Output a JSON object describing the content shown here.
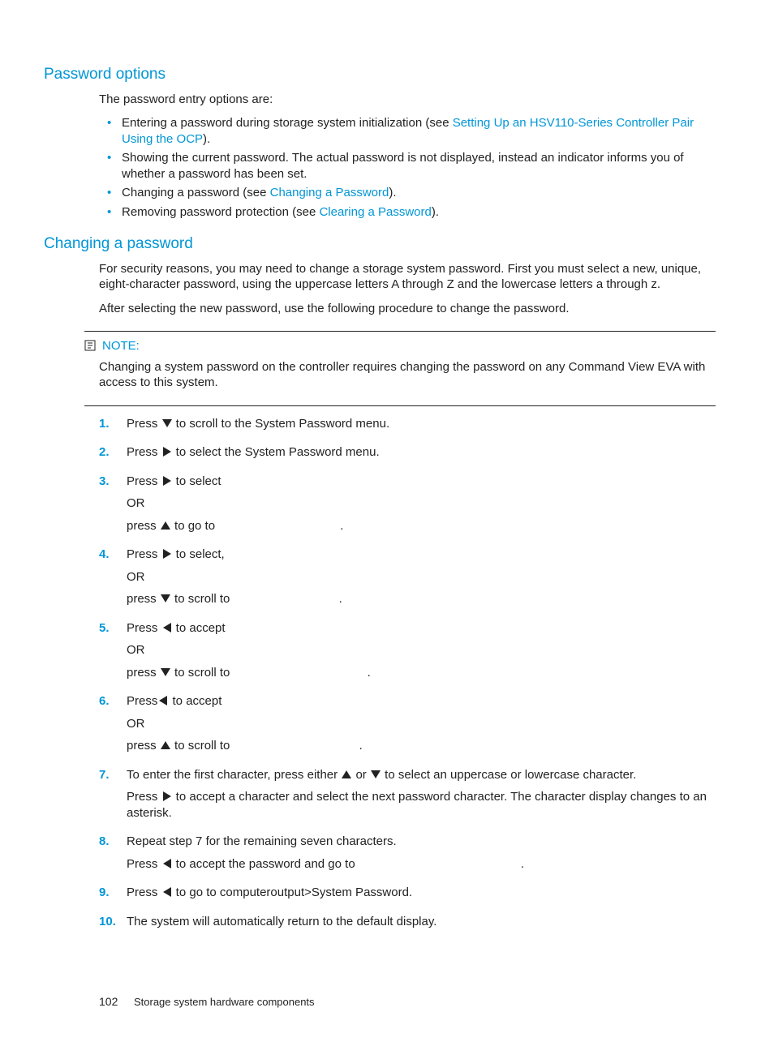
{
  "section1": {
    "title": "Password options",
    "intro": "The password entry options are:",
    "bullets": [
      {
        "pre": "Entering a password during storage system initialization (see ",
        "link": "Setting Up an HSV110-Series Controller Pair Using the OCP",
        "post": ")."
      },
      {
        "pre": "Showing the current password. The actual password is not displayed, instead an indicator informs you of whether a password has been set.",
        "link": "",
        "post": ""
      },
      {
        "pre": "Changing a password (see ",
        "link": "Changing a Password",
        "post": ")."
      },
      {
        "pre": "Removing password protection (see ",
        "link": "Clearing a Password",
        "post": ")."
      }
    ]
  },
  "section2": {
    "title": "Changing a password",
    "p1": "For security reasons, you may need to change a storage system password. First you must select a new, unique, eight-character password, using the uppercase letters A through Z and the lowercase letters a through z.",
    "p2": "After selecting the new password, use the following procedure to change the password.",
    "note_label": "NOTE:",
    "note_body": "Changing a system password on the controller requires changing the password on any Command View EVA with access to this system.",
    "steps": {
      "s1_a": "Press ",
      "s1_b": " to scroll to the System Password menu.",
      "s2_a": "Press ",
      "s2_b": " to select the System Password menu.",
      "s3_a": "Press ",
      "s3_b": " to select",
      "s3_or": "OR",
      "s3_c": "press ",
      "s3_d": " to go to ",
      "s3_e": ".",
      "s4_a": "Press ",
      "s4_b": " to select,",
      "s4_or": "OR",
      "s4_c": "press ",
      "s4_d": " to scroll to ",
      "s4_e": ".",
      "s5_a": "Press ",
      "s5_b": " to accept",
      "s5_or": "OR",
      "s5_c": "press ",
      "s5_d": " to scroll to ",
      "s5_e": ".",
      "s6_a": "Press",
      "s6_b": " to accept",
      "s6_or": "OR",
      "s6_c": "press ",
      "s6_d": " to scroll to ",
      "s6_e": ".",
      "s7_a": "To enter the first character, press either ",
      "s7_b": " or ",
      "s7_c": " to select an uppercase or lowercase character.",
      "s7_d": "Press ",
      "s7_e": " to accept a character and select the next password character. The character display changes to an asterisk.",
      "s8_a": "Repeat step 7 for the remaining seven characters.",
      "s8_b": "Press ",
      "s8_c": " to accept the password and go to ",
      "s8_d": ".",
      "s9_a": "Press ",
      "s9_b": " to go to computeroutput>System Password.",
      "s10": "The system will automatically return to the default display."
    }
  },
  "footer": {
    "page": "102",
    "title": "Storage system hardware components"
  }
}
